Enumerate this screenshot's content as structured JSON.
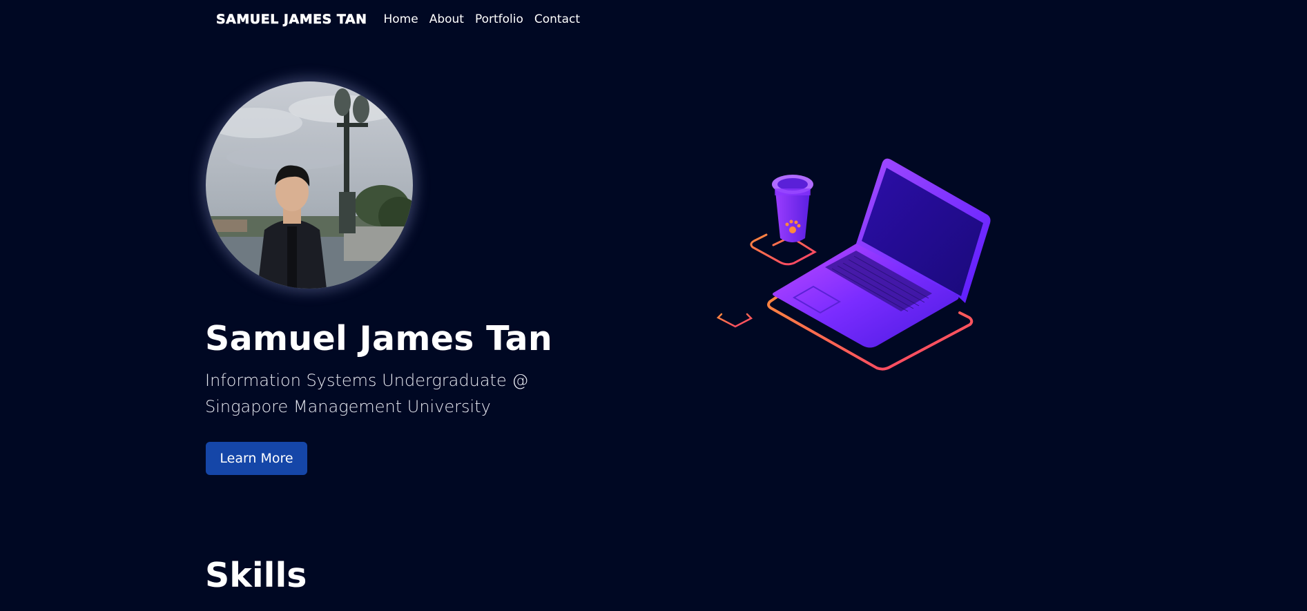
{
  "nav": {
    "brand": "SAMUEL JAMES TAN",
    "links": [
      "Home",
      "About",
      "Portfolio",
      "Contact"
    ]
  },
  "hero": {
    "name": "Samuel James Tan",
    "subtitle_line1": "Information Systems Undergraduate @",
    "subtitle_line2": "Singapore Management University",
    "cta_label": "Learn More",
    "avatar_icon": "profile-photo",
    "illustration_icon": "laptop-and-cup-illustration"
  },
  "sections": {
    "skills_title": "Skills"
  },
  "colors": {
    "background": "#000823",
    "button": "#1546a8",
    "text": "#ffffff",
    "illustration_purple": "#7b2cff",
    "illustration_orange": "#ff6b3a"
  }
}
